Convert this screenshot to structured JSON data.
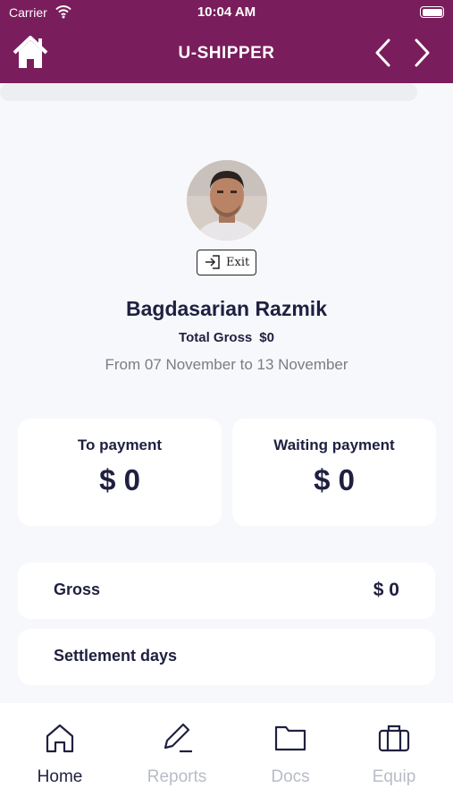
{
  "status_bar": {
    "carrier": "Carrier",
    "time": "10:04 AM"
  },
  "header": {
    "title": "U-SHIPPER",
    "brand_color": "#7a1d5c"
  },
  "profile": {
    "exit_label": "Exit",
    "name": "Bagdasarian Razmik",
    "total_gross_label": "Total Gross",
    "total_gross_value": "$0",
    "date_range": "From 07 November to 13 November"
  },
  "stats": {
    "to_payment_label": "To payment",
    "to_payment_value": "$ 0",
    "waiting_payment_label": "Waiting payment",
    "waiting_payment_value": "$ 0"
  },
  "rows": {
    "gross_label": "Gross",
    "gross_value": "$ 0",
    "settlement_label": "Settlement days"
  },
  "tabs": [
    {
      "label": "Home",
      "icon": "home-icon",
      "active": true
    },
    {
      "label": "Reports",
      "icon": "pencil-icon",
      "active": false
    },
    {
      "label": "Docs",
      "icon": "folder-icon",
      "active": false
    },
    {
      "label": "Equip",
      "icon": "briefcase-icon",
      "active": false
    }
  ]
}
